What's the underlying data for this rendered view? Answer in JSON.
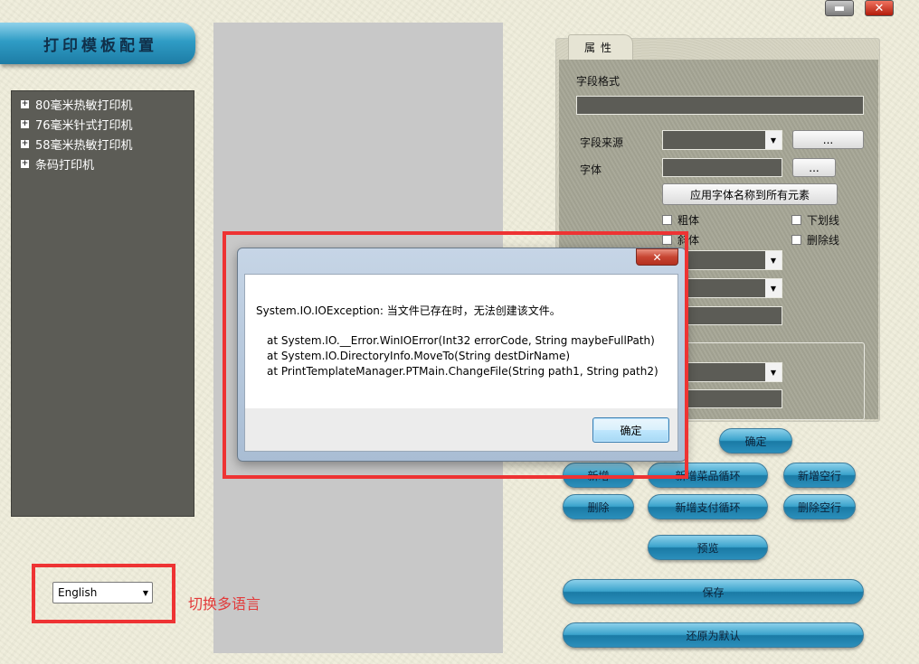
{
  "window": {
    "minimize_label": "▬",
    "close_label": "✕"
  },
  "header": {
    "title": "打印模板配置"
  },
  "tree": {
    "items": [
      {
        "label": "80毫米热敏打印机"
      },
      {
        "label": "76毫米针式打印机"
      },
      {
        "label": "58毫米热敏打印机"
      },
      {
        "label": "条码打印机"
      }
    ]
  },
  "properties": {
    "tab_label": "属性",
    "field_format_label": "字段格式",
    "field_source_label": "字段来源",
    "font_label": "字体",
    "browse_label": "...",
    "apply_font_label": "应用字体名称到所有元素",
    "bold_label": "粗体",
    "italic_label": "斜体",
    "underline_label": "下划线",
    "strikeout_label": "删除线",
    "confirm_label": "确定"
  },
  "actions": {
    "add_label": "新增",
    "add_dish_loop_label": "新增菜品循环",
    "add_blank_row_label": "新增空行",
    "delete_label": "删除",
    "add_payment_loop_label": "新增支付循环",
    "delete_blank_row_label": "删除空行",
    "preview_label": "预览",
    "save_label": "保存",
    "restore_default_label": "还原为默认"
  },
  "language": {
    "selected": "English",
    "annotation": "切换多语言"
  },
  "dialog": {
    "close_label": "✕",
    "message": "System.IO.IOException: 当文件已存在时，无法创建该文件。",
    "stack": [
      "at System.IO.__Error.WinIOError(Int32 errorCode, String maybeFullPath)",
      "at System.IO.DirectoryInfo.MoveTo(String destDirName)",
      "at PrintTemplateManager.PTMain.ChangeFile(String path1, String path2)"
    ],
    "ok_label": "确定"
  },
  "colors": {
    "accent_blue": "#2f9cc5",
    "highlight_red": "#ee3333",
    "panel_dark": "#5c5c56"
  }
}
